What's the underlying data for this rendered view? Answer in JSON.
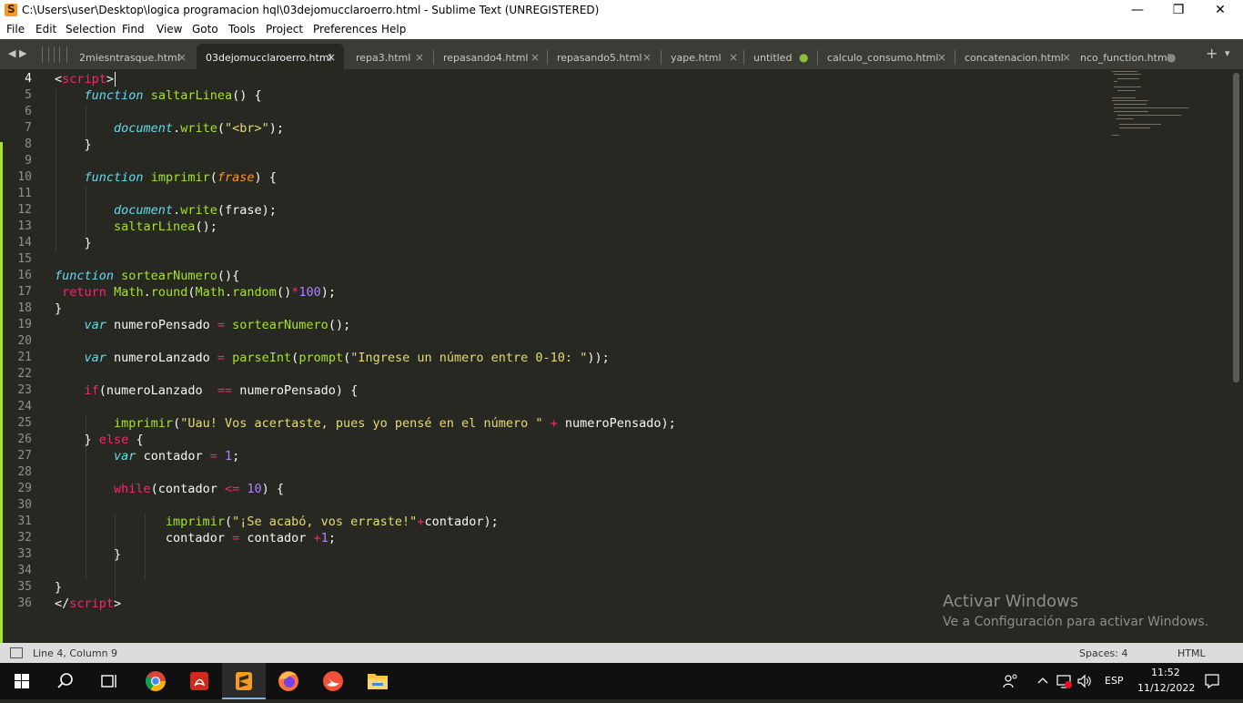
{
  "window": {
    "title": "C:\\Users\\user\\Desktop\\logica programacion hql\\03dejomucclaroerro.html - Sublime Text (UNREGISTERED)",
    "minimize": "—",
    "maximize": "❐",
    "close": "✕"
  },
  "menu": [
    "File",
    "Edit",
    "Selection",
    "Find",
    "View",
    "Goto",
    "Tools",
    "Project",
    "Preferences",
    "Help"
  ],
  "tabs": [
    {
      "label": "2miesntrasque.html",
      "close": "×"
    },
    {
      "label": "03dejomucclaroerro.html",
      "close": "×",
      "active": true
    },
    {
      "label": "repa3.html",
      "close": "×"
    },
    {
      "label": "repasando4.html",
      "close": "×"
    },
    {
      "label": "repasando5.html",
      "close": "×"
    },
    {
      "label": "yape.html",
      "close": "×"
    },
    {
      "label": "untitled",
      "close": "●"
    },
    {
      "label": "calculo_consumo.html",
      "close": "×"
    },
    {
      "label": "concatenacion.html",
      "close": "×"
    },
    {
      "label": "nco_function.html",
      "close": "●"
    }
  ],
  "tabbar_controls": {
    "left": "◀ ▶",
    "add": "+",
    "dropdown": "▾"
  },
  "line_numbers": [
    "4",
    "5",
    "6",
    "7",
    "8",
    "9",
    "10",
    "11",
    "12",
    "13",
    "14",
    "15",
    "16",
    "17",
    "18",
    "19",
    "20",
    "21",
    "22",
    "23",
    "24",
    "25",
    "26",
    "27",
    "28",
    "29",
    "30",
    "31",
    "32",
    "33",
    "34",
    "35",
    "36"
  ],
  "code": {
    "l4_open": "<",
    "l4_tag": "script",
    "l4_close": ">",
    "l5_kw": "function",
    "l5_fn": "saltarLinea",
    "l5_rest": "() {",
    "l7_obj": "document",
    "l7_dot": ".",
    "l7_fn": "write",
    "l7_p1": "(",
    "l7_str": "\"<br>\"",
    "l7_p2": ");",
    "l8": "}",
    "l10_kw": "function",
    "l10_fn": "imprimir",
    "l10_p1": "(",
    "l10_par": "frase",
    "l10_p2": ") {",
    "l12_obj": "document",
    "l12_dot": ".",
    "l12_fn": "write",
    "l12_rest": "(frase);",
    "l13_fn": "saltarLinea",
    "l13_rest": "();",
    "l14": "}",
    "l16_kw": "function",
    "l16_fn": "sortearNumero",
    "l16_rest": "(){",
    "l17_kw": "return",
    "l17_m1": "Math",
    "l17_d1": ".",
    "l17_f1": "round",
    "l17_p1": "(",
    "l17_m2": "Math",
    "l17_d2": ".",
    "l17_f2": "random",
    "l17_p2": "()",
    "l17_op": "*",
    "l17_num": "100",
    "l17_end": ");",
    "l18": "}",
    "l19_kw": "var",
    "l19_name": "numeroPensado",
    "l19_op": "=",
    "l19_fn": "sortearNumero",
    "l19_rest": "();",
    "l21_kw": "var",
    "l21_name": "numeroLanzado",
    "l21_op": "=",
    "l21_fn1": "parseInt",
    "l21_p1": "(",
    "l21_fn2": "prompt",
    "l21_p2": "(",
    "l21_str": "\"Ingrese un número entre 0-10: \"",
    "l21_end": "));",
    "l23_kw": "if",
    "l23_a": "(numeroLanzado",
    "l23_op": "==",
    "l23_b": "numeroPensado) {",
    "l25_fn": "imprimir",
    "l25_p1": "(",
    "l25_str": "\"Uau! Vos acertaste, pues yo pensé en el número \"",
    "l25_op": "+",
    "l25_rest": "numeroPensado);",
    "l26_a": "}",
    "l26_kw": "else",
    "l26_b": "{",
    "l27_kw": "var",
    "l27_name": "contador",
    "l27_op": "=",
    "l27_num": "1",
    "l27_end": ";",
    "l29_kw": "while",
    "l29_a": "(contador",
    "l29_op": "<=",
    "l29_num": "10",
    "l29_end": ") {",
    "l31_fn": "imprimir",
    "l31_p1": "(",
    "l31_str": "\"¡Se acabó, vos erraste!\"",
    "l31_op": "+",
    "l31_rest": "contador);",
    "l32_a": "contador",
    "l32_op1": "=",
    "l32_b": "contador",
    "l32_op2": "+",
    "l32_num": "1",
    "l32_end": ";",
    "l33": "}",
    "l35": "}",
    "l36_open": "</",
    "l36_tag": "script",
    "l36_close": ">"
  },
  "watermark": {
    "line1": "Activar Windows",
    "line2": "Ve a Configuración para activar Windows."
  },
  "status": {
    "position": "Line 4, Column 9",
    "spaces": "Spaces: 4",
    "syntax": "HTML"
  },
  "tray": {
    "lang": "ESP",
    "time": "11:52",
    "date": "11/12/2022"
  },
  "colors": {
    "editor_bg": "#272822",
    "keyword": "#66d9ef",
    "function": "#a6e22e",
    "string": "#e6db74",
    "number": "#ae81ff",
    "operator": "#f92672",
    "parameter": "#fd971f"
  }
}
